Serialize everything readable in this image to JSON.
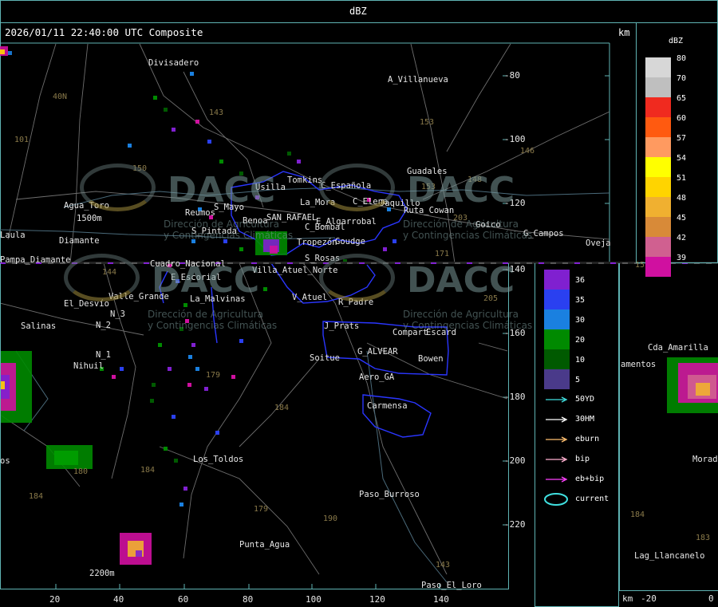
{
  "header": {
    "title": "dBZ"
  },
  "subheader": {
    "timestamp": "2026/01/11 22:40:00 UTC Composite",
    "unit": "km"
  },
  "legend": {
    "title": "dBZ",
    "bins": [
      {
        "value": "80",
        "color": "#d7d7d7"
      },
      {
        "value": "70",
        "color": "#bfbfbf"
      },
      {
        "value": "65",
        "color": "#f02a1f"
      },
      {
        "value": "60",
        "color": "#ff5a10"
      },
      {
        "value": "57",
        "color": "#ff9a60"
      },
      {
        "value": "54",
        "color": "#ffff00"
      },
      {
        "value": "51",
        "color": "#ffd400"
      },
      {
        "value": "48",
        "color": "#f0b030"
      },
      {
        "value": "45",
        "color": "#d88a38"
      },
      {
        "value": "42",
        "color": "#d06090"
      },
      {
        "value": "39",
        "color": "#d010a0"
      },
      {
        "value": "36",
        "color": "#8020d0"
      },
      {
        "value": "35",
        "color": "#2a40f0"
      },
      {
        "value": "30",
        "color": "#1a80e0"
      },
      {
        "value": "20",
        "color": "#008a00"
      },
      {
        "value": "10",
        "color": "#005a00"
      },
      {
        "value": "5",
        "color": "#4a3a8a"
      }
    ],
    "tracks": [
      {
        "label": "50YD",
        "color": "#40e0e0"
      },
      {
        "label": "30HM",
        "color": "#ffffff"
      },
      {
        "label": "eburn",
        "color": "#ffc070"
      },
      {
        "label": "bip",
        "color": "#ffb0d0"
      },
      {
        "label": "eb+bip",
        "color": "#ff40ff"
      },
      {
        "label": "current",
        "color": "#40e0e0"
      }
    ]
  },
  "axes": {
    "y_ticks": [
      "-80",
      "-100",
      "-120",
      "-140",
      "-160",
      "-180",
      "-200",
      "-220"
    ],
    "x_ticks": [
      "20",
      "40",
      "60",
      "80",
      "100",
      "120",
      "140"
    ],
    "second_panel_x": [
      "km",
      "-20",
      "0"
    ]
  },
  "places": [
    {
      "name": "Divisadero"
    },
    {
      "name": "A_Villanueva"
    },
    {
      "name": "40N"
    },
    {
      "name": "101"
    },
    {
      "name": "143"
    },
    {
      "name": "153"
    },
    {
      "name": "146"
    },
    {
      "name": "150"
    },
    {
      "name": "Tomkins"
    },
    {
      "name": "Usilla"
    },
    {
      "name": "C_Española"
    },
    {
      "name": "Guadales"
    },
    {
      "name": "153"
    },
    {
      "name": "148"
    },
    {
      "name": "Agua_Toro"
    },
    {
      "name": "1500m"
    },
    {
      "name": "Reumos"
    },
    {
      "name": "S_Mayo"
    },
    {
      "name": "La_Mora"
    },
    {
      "name": "C_Elena"
    },
    {
      "name": "Jaquillo"
    },
    {
      "name": "Ruta_Cowan"
    },
    {
      "name": "SAN_RAFAEL"
    },
    {
      "name": "Benoa"
    },
    {
      "name": "E_Algarrobal"
    },
    {
      "name": "Goico"
    },
    {
      "name": "203"
    },
    {
      "name": "Laula"
    },
    {
      "name": "Diamante"
    },
    {
      "name": "S_Pintada"
    },
    {
      "name": "C_Bombal"
    },
    {
      "name": "G_Campos"
    },
    {
      "name": "Oveja"
    },
    {
      "name": "Pampa_Diamante"
    },
    {
      "name": "Tropezón"
    },
    {
      "name": "Goudge"
    },
    {
      "name": "S_Rosas"
    },
    {
      "name": "171"
    },
    {
      "name": "144"
    },
    {
      "name": "Cuadro_Nacional"
    },
    {
      "name": "Villa_Atuel_Norte"
    },
    {
      "name": "E_Escorial"
    },
    {
      "name": "El_Desvío"
    },
    {
      "name": "Valle_Grande"
    },
    {
      "name": "La_Malvinas"
    },
    {
      "name": "V_Atuel"
    },
    {
      "name": "R_Padre"
    },
    {
      "name": "205"
    },
    {
      "name": "N_3"
    },
    {
      "name": "Salinas"
    },
    {
      "name": "N_2"
    },
    {
      "name": "J_Prats"
    },
    {
      "name": "Compart"
    },
    {
      "name": "Escard"
    },
    {
      "name": "N_1"
    },
    {
      "name": "G_ALVEAR"
    },
    {
      "name": "Soitue"
    },
    {
      "name": "Bowen"
    },
    {
      "name": "Nihuil"
    },
    {
      "name": "179"
    },
    {
      "name": "Aero_GA"
    },
    {
      "name": "Carmensa"
    },
    {
      "name": "184"
    },
    {
      "name": "Los_Toldos"
    },
    {
      "name": "180"
    },
    {
      "name": "184"
    },
    {
      "name": "Paso_Burroso"
    },
    {
      "name": "184"
    },
    {
      "name": "179"
    },
    {
      "name": "190"
    },
    {
      "name": "Punta_Agua"
    },
    {
      "name": "143"
    },
    {
      "name": "2200m"
    },
    {
      "name": "Paso_El_Loro"
    },
    {
      "name": "Cda_Amarilla"
    },
    {
      "name": "amentos"
    },
    {
      "name": "Morado"
    },
    {
      "name": "184"
    },
    {
      "name": "183"
    },
    {
      "name": "Lag_Llancanelo"
    },
    {
      "name": "os"
    },
    {
      "name": "15"
    }
  ],
  "watermark": {
    "brand": "DACC",
    "line1": "Dirección de Agricultura",
    "line2": "y Contingencias Climáticas"
  }
}
